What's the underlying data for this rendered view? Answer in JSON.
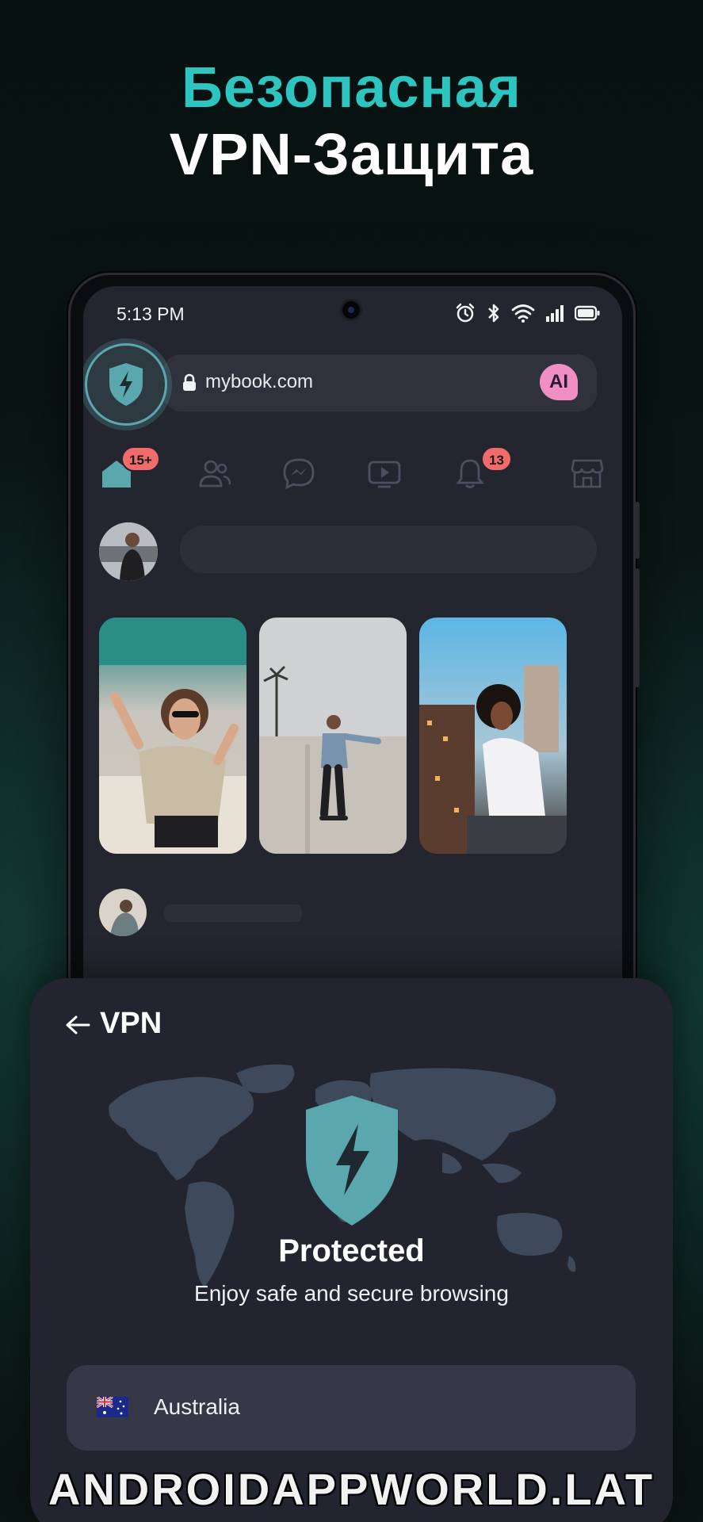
{
  "headline": {
    "line1": "Безопасная",
    "line2": "VPN-Защита"
  },
  "status_bar": {
    "time": "5:13 PM",
    "icons": [
      "alarm-icon",
      "bluetooth-icon",
      "wifi-icon",
      "signal-icon",
      "battery-icon"
    ]
  },
  "browser": {
    "url": "mybook.com",
    "ai_label": "AI",
    "vpn_button_icon": "shield-bolt-icon"
  },
  "nav": {
    "items": [
      {
        "icon": "home-icon",
        "badge": "15+"
      },
      {
        "icon": "friends-icon",
        "badge": ""
      },
      {
        "icon": "messenger-icon",
        "badge": ""
      },
      {
        "icon": "video-icon",
        "badge": ""
      },
      {
        "icon": "bell-icon",
        "badge": "13"
      },
      {
        "icon": "marketplace-icon",
        "badge": ""
      }
    ]
  },
  "vpn_sheet": {
    "title": "VPN",
    "status": "Protected",
    "subtitle": "Enjoy safe and secure browsing",
    "country": "Australia",
    "accent_color": "#5aa7ad"
  },
  "watermark": "ANDROIDAPPWORLD.LAT"
}
